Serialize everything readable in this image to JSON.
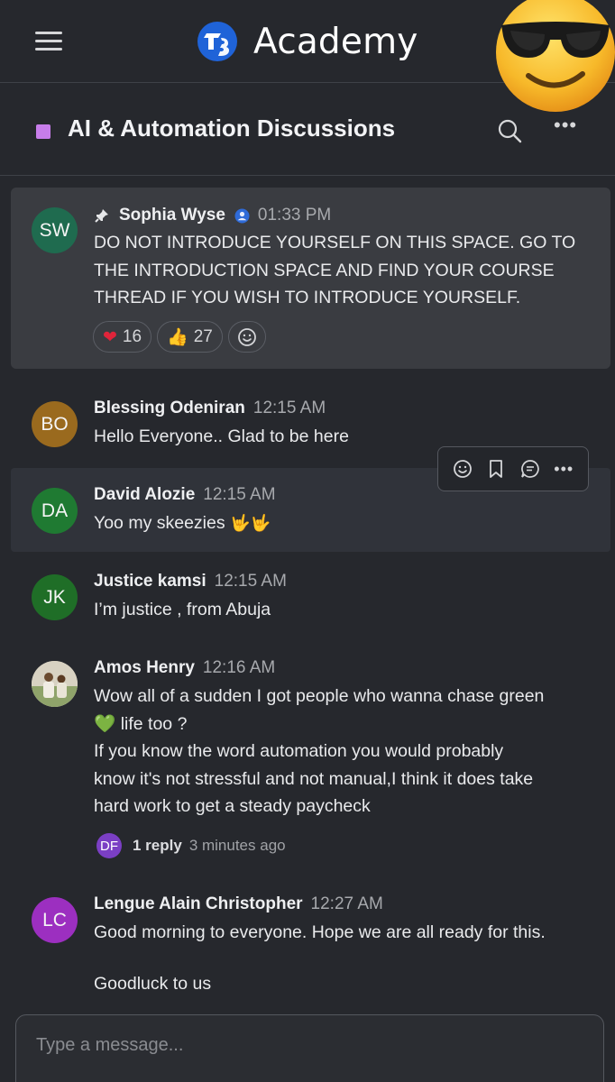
{
  "header": {
    "app_title": "Academy"
  },
  "channel": {
    "title": "AI & Automation Discussions",
    "color": "#c77dea"
  },
  "messages": [
    {
      "initials": "SW",
      "avatar_color": "#1f6b4f",
      "author": "Sophia Wyse",
      "time": "01:33 PM",
      "pinned": true,
      "lines": [
        "DO NOT INTRODUCE YOURSELF ON THIS SPACE. GO TO",
        "THE INTRODUCTION SPACE AND FIND YOUR COURSE",
        "THREAD IF YOU WISH TO INTRODUCE YOURSELF."
      ],
      "reactions": [
        {
          "emoji": "❤",
          "count": "16"
        },
        {
          "emoji": "👍",
          "count": "27"
        }
      ]
    },
    {
      "initials": "BO",
      "avatar_color": "#9a6a1e",
      "author": "Blessing Odeniran",
      "time": "12:15 AM",
      "lines": [
        "Hello Everyone.. Glad to be here"
      ]
    },
    {
      "initials": "DA",
      "avatar_color": "#1f7a32",
      "author": "David Alozie",
      "time": "12:15 AM",
      "text": "Yoo my skeezies",
      "emoji": "🤟🤟"
    },
    {
      "initials": "JK",
      "avatar_color": "#1f6e27",
      "author": "Justice kamsi",
      "time": "12:15 AM",
      "lines": [
        "I’m justice , from Abuja"
      ]
    },
    {
      "initials": "",
      "avatar_color": "#c9c0aa",
      "author": "Amos Henry",
      "time": "12:16 AM",
      "line1": "Wow all of a sudden I got people who wanna chase green",
      "line2_emoji": "💚",
      "line2": "life too ?",
      "lines_rest": [
        "If you know the word automation you would probably",
        "know it's not stressful and not manual,I think it does take",
        "hard work to get a steady paycheck"
      ],
      "thread": {
        "initials": "DF",
        "count": "1 reply",
        "time": "3 minutes ago"
      }
    },
    {
      "initials": "LC",
      "avatar_color": "#9c2fc0",
      "author": "Lengue Alain Christopher",
      "time": "12:27 AM",
      "lines": [
        "Good morning to everyone. Hope we are all ready for this."
      ],
      "line_after_gap": "Goodluck to us"
    }
  ],
  "composer": {
    "placeholder": "Type a message..."
  }
}
